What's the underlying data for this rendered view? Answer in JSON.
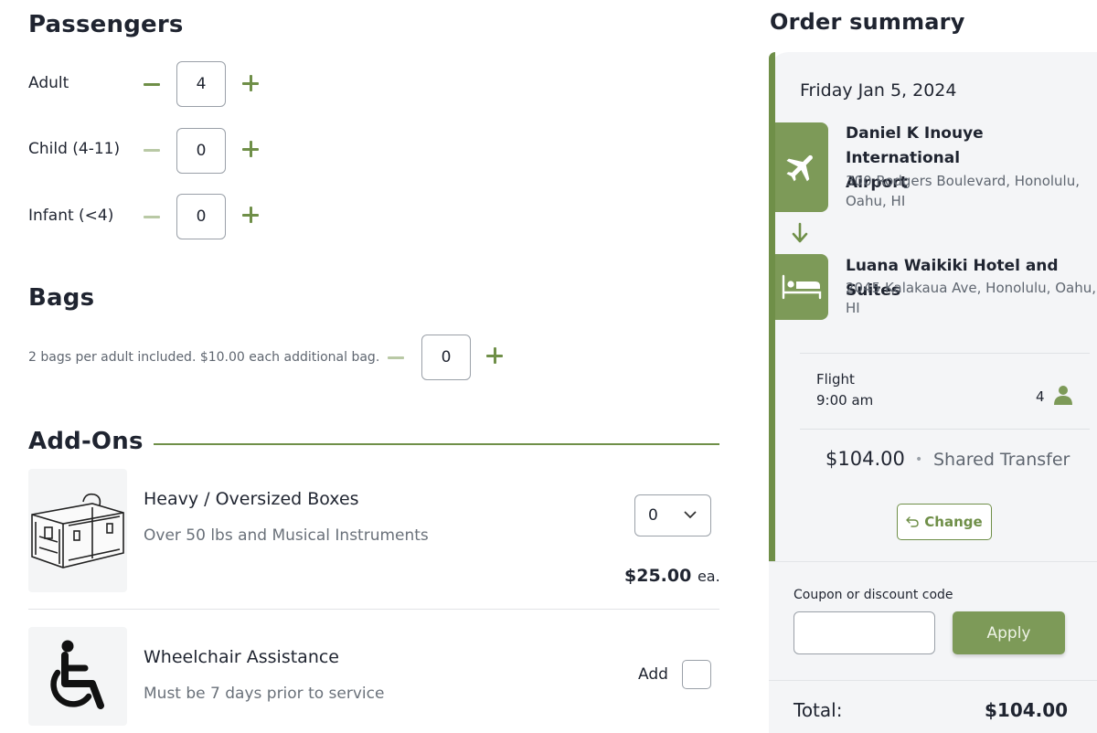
{
  "passengers": {
    "title": "Passengers",
    "rows": [
      {
        "label": "Adult",
        "value": "4"
      },
      {
        "label": "Child (4-11)",
        "value": "0"
      },
      {
        "label": "Infant (<4)",
        "value": "0"
      }
    ]
  },
  "bags": {
    "title": "Bags",
    "note": "2 bags per adult included. $10.00 each additional bag.",
    "value": "0"
  },
  "addons": {
    "title": "Add-Ons",
    "items": [
      {
        "title": "Heavy / Oversized Boxes",
        "subtitle": "Over 50 lbs and Musical Instruments",
        "select_value": "0",
        "price": "$25.00",
        "price_unit": "ea.",
        "icon": "suitcase-icon"
      },
      {
        "title": "Wheelchair Assistance",
        "subtitle": "Must be 7 days prior to service",
        "add_label": "Add",
        "icon": "wheelchair-icon"
      }
    ]
  },
  "summary": {
    "title": "Order summary",
    "date": "Friday Jan 5, 2024",
    "pickup": {
      "name_line1": "Daniel K Inouye International",
      "name_line2": "Airport",
      "addr_line1": "300 Rodgers Boulevard, Honolulu,",
      "addr_line2": "Oahu, HI",
      "icon": "airplane-icon"
    },
    "dropoff": {
      "name": "Luana Waikiki Hotel and Suites",
      "addr_line1": "2045 Kalakaua Ave, Honolulu, Oahu,",
      "addr_line2": "HI",
      "icon": "bed-icon"
    },
    "flight_label": "Flight",
    "flight_time": "9:00 am",
    "passenger_count": "4",
    "price": "$104.00",
    "separator": "•",
    "service": "Shared Transfer",
    "change_label": "Change",
    "coupon_label": "Coupon or discount code",
    "coupon_value": "",
    "apply_label": "Apply",
    "total_label": "Total:",
    "total_value": "$104.00"
  },
  "colors": {
    "accent": "#6f8f48",
    "accent_tab": "#7d9a58",
    "card_bg": "#f4f5f7"
  }
}
